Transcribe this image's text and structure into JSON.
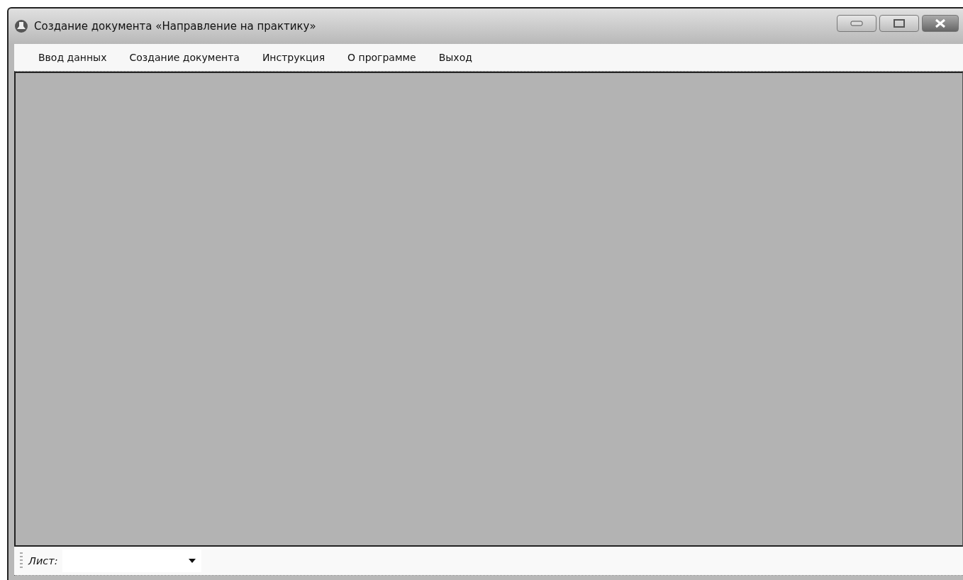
{
  "window": {
    "title": "Создание документа «Направление на практику»"
  },
  "menu": [
    {
      "label": "Ввод данных"
    },
    {
      "label": "Создание документа"
    },
    {
      "label": "Инструкция"
    },
    {
      "label": "О программе"
    },
    {
      "label": "Выход"
    }
  ],
  "toolbar": {
    "label": "Лист:"
  }
}
